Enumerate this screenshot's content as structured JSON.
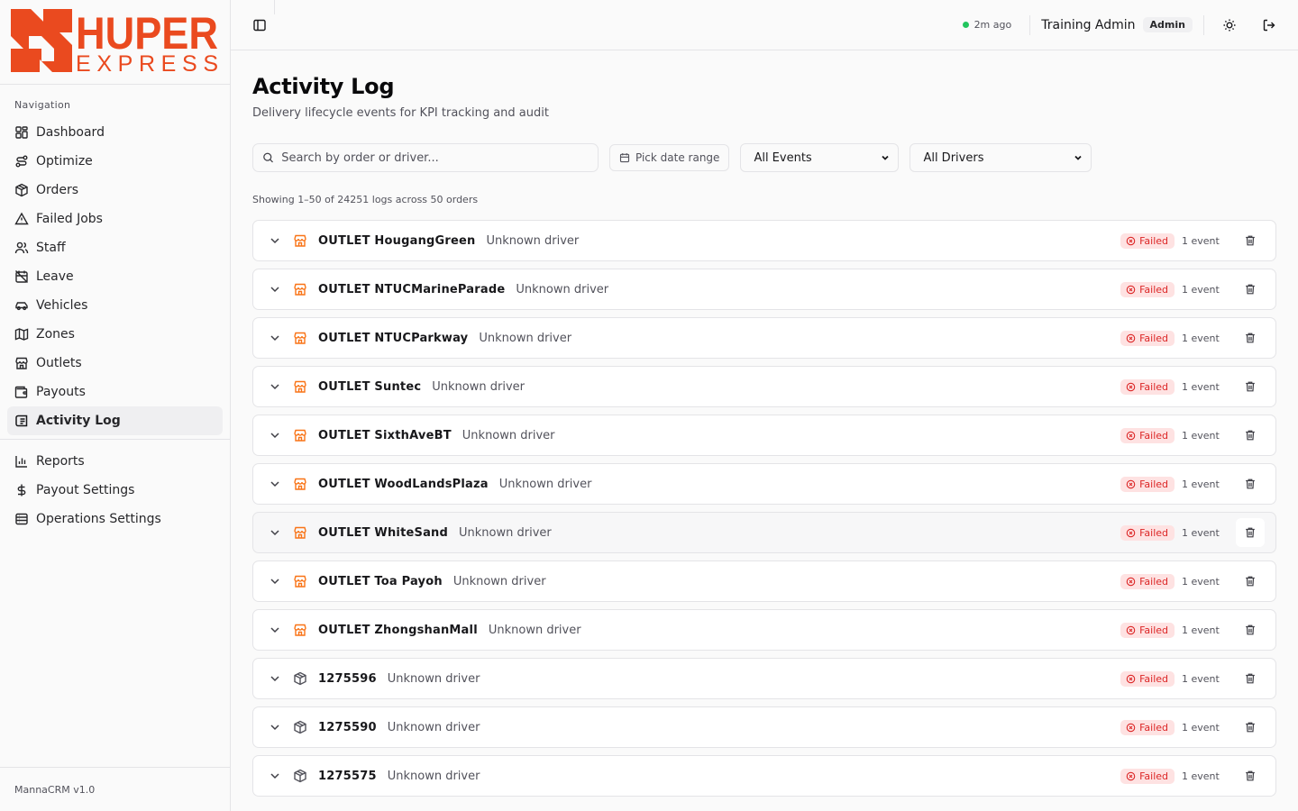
{
  "brand": {
    "name_top": "HUPER",
    "name_bottom": "EXPRESS",
    "accent": "#ea4a1f"
  },
  "sidebar": {
    "section_label": "Navigation",
    "items": [
      {
        "label": "Dashboard",
        "icon": "dashboard-icon"
      },
      {
        "label": "Optimize",
        "icon": "route-icon"
      },
      {
        "label": "Orders",
        "icon": "package-icon"
      },
      {
        "label": "Failed Jobs",
        "icon": "warning-icon"
      },
      {
        "label": "Staff",
        "icon": "users-icon"
      },
      {
        "label": "Leave",
        "icon": "calendar-off-icon"
      },
      {
        "label": "Vehicles",
        "icon": "car-icon"
      },
      {
        "label": "Zones",
        "icon": "map-icon"
      },
      {
        "label": "Outlets",
        "icon": "store-icon"
      },
      {
        "label": "Payouts",
        "icon": "wallet-icon"
      },
      {
        "label": "Activity Log",
        "icon": "logs-icon",
        "active": true
      }
    ],
    "items2": [
      {
        "label": "Reports",
        "icon": "bar-chart-icon"
      },
      {
        "label": "Payout Settings",
        "icon": "dollar-icon"
      },
      {
        "label": "Operations Settings",
        "icon": "settings-icon"
      }
    ],
    "footer": "MannaCRM v1.0"
  },
  "topbar": {
    "status_text": "2m ago",
    "status_color": "#22c55e",
    "user_name": "Training Admin",
    "role": "Admin"
  },
  "page": {
    "title": "Activity Log",
    "subtitle": "Delivery lifecycle events for KPI tracking and audit"
  },
  "filters": {
    "search_placeholder": "Search by order or driver...",
    "date_label": "Pick date range",
    "events_value": "All Events",
    "drivers_value": "All Drivers"
  },
  "showing_text": "Showing 1–50 of 24251 logs across 50 orders",
  "rows": [
    {
      "type": "outlet",
      "title": "OUTLET HougangGreen",
      "driver": "Unknown driver",
      "status": "Failed",
      "count": "1 event"
    },
    {
      "type": "outlet",
      "title": "OUTLET NTUCMarineParade",
      "driver": "Unknown driver",
      "status": "Failed",
      "count": "1 event"
    },
    {
      "type": "outlet",
      "title": "OUTLET NTUCParkway",
      "driver": "Unknown driver",
      "status": "Failed",
      "count": "1 event"
    },
    {
      "type": "outlet",
      "title": "OUTLET Suntec",
      "driver": "Unknown driver",
      "status": "Failed",
      "count": "1 event"
    },
    {
      "type": "outlet",
      "title": "OUTLET SixthAveBT",
      "driver": "Unknown driver",
      "status": "Failed",
      "count": "1 event"
    },
    {
      "type": "outlet",
      "title": "OUTLET WoodLandsPlaza",
      "driver": "Unknown driver",
      "status": "Failed",
      "count": "1 event"
    },
    {
      "type": "outlet",
      "title": "OUTLET WhiteSand",
      "driver": "Unknown driver",
      "status": "Failed",
      "count": "1 event",
      "hover": true
    },
    {
      "type": "outlet",
      "title": "OUTLET Toa Payoh",
      "driver": "Unknown driver",
      "status": "Failed",
      "count": "1 event"
    },
    {
      "type": "outlet",
      "title": "OUTLET ZhongshanMall",
      "driver": "Unknown driver",
      "status": "Failed",
      "count": "1 event"
    },
    {
      "type": "order",
      "title": "1275596",
      "driver": "Unknown driver",
      "status": "Failed",
      "count": "1 event"
    },
    {
      "type": "order",
      "title": "1275590",
      "driver": "Unknown driver",
      "status": "Failed",
      "count": "1 event"
    },
    {
      "type": "order",
      "title": "1275575",
      "driver": "Unknown driver",
      "status": "Failed",
      "count": "1 event"
    }
  ]
}
